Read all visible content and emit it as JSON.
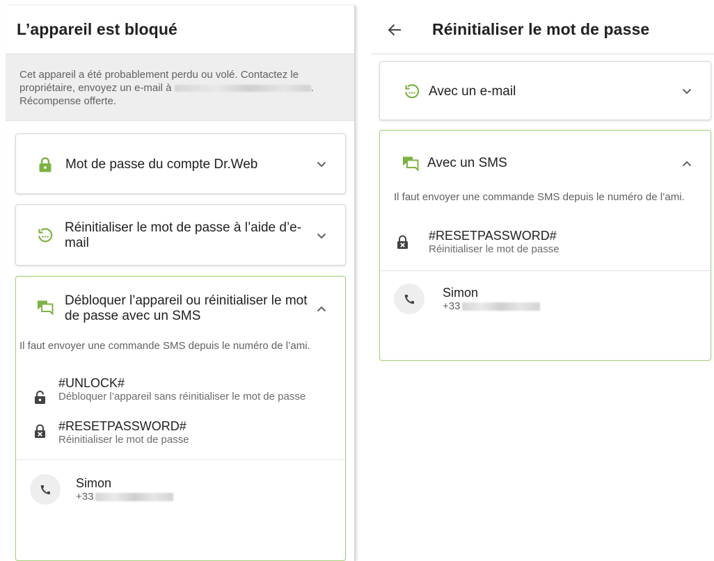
{
  "left": {
    "title": "L’appareil est bloqué",
    "notice": "Cet appareil a été probablement perdu ou volé. Contactez le propriétaire, envoyez un e-mail à",
    "notice_end": ".",
    "notice_line3": "Récompense offerte.",
    "cards": {
      "password": {
        "label": "Mot de passe du compte Dr.Web",
        "icon": "lock-icon"
      },
      "email_reset": {
        "label": "Réinitialiser le mot de passe à l’aide d’e-mail",
        "icon": "email-reset-icon"
      },
      "sms": {
        "label": "Débloquer l’appareil ou réinitialiser le mot de passe avec un SMS",
        "icon": "sms-icon",
        "description": "Il faut envoyer une commande SMS depuis le numéro de l’ami.",
        "commands": [
          {
            "name": "#UNLOCK#",
            "sub": "Débloquer l’appareil sans réinitialiser le mot de passe",
            "icon": "unlock-icon"
          },
          {
            "name": "#RESETPASSWORD#",
            "sub": "Réinitialiser le mot de passe",
            "icon": "lock-reset-icon"
          }
        ],
        "contact": {
          "name": "Simon",
          "phone_prefix": "+33"
        }
      }
    }
  },
  "right": {
    "title": "Réinitialiser le mot de passe",
    "cards": {
      "email": {
        "label": "Avec un e-mail",
        "icon": "email-reset-icon"
      },
      "sms": {
        "label": "Avec un SMS",
        "icon": "sms-icon",
        "description": "Il faut envoyer une commande SMS depuis le numéro de l’ami.",
        "commands": [
          {
            "name": "#RESETPASSWORD#",
            "sub": "Réinitialiser le mot de passe",
            "icon": "lock-reset-icon"
          }
        ],
        "contact": {
          "name": "Simon",
          "phone_prefix": "+33"
        }
      }
    }
  },
  "colors": {
    "accent": "#7cb342",
    "card_border_expanded": "#a5d07a",
    "notice_bg": "#eeeeee"
  }
}
